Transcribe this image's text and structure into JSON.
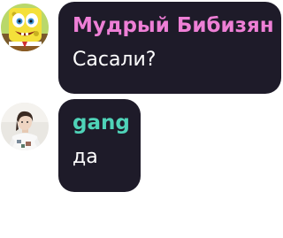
{
  "chat": {
    "messages": [
      {
        "sender": "Мудрый Бибизян",
        "sender_color": "#ee7fd6",
        "text": "Сасали?",
        "avatar_icon": "sponge-character-avatar"
      },
      {
        "sender": "gang",
        "sender_color": "#4fd3b8",
        "text": "да",
        "avatar_icon": "user-photo-avatar"
      }
    ]
  },
  "colors": {
    "bubble_background": "#1e1b29",
    "message_text": "#ffffff",
    "page_background": "#ffffff"
  }
}
